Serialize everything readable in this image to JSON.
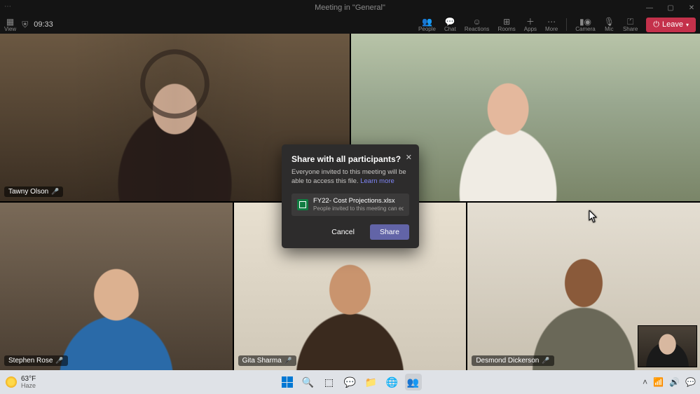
{
  "titlebar": {
    "title": "Meeting in \"General\""
  },
  "toolbar": {
    "view_label": "View",
    "time": "09:33",
    "actions": {
      "people": "People",
      "chat": "Chat",
      "reactions": "Reactions",
      "rooms": "Rooms",
      "apps": "Apps",
      "more": "More",
      "camera": "Camera",
      "mic": "Mic",
      "share": "Share"
    },
    "leave_label": "Leave"
  },
  "participants": [
    {
      "name": "Tawny Olson"
    },
    {
      "name": ""
    },
    {
      "name": "Stephen Rose"
    },
    {
      "name": "Gita Sharma"
    },
    {
      "name": "Desmond Dickerson"
    }
  ],
  "dialog": {
    "title": "Share with all participants?",
    "body": "Everyone invited to this meeting will be able to access this file.",
    "learn_more": "Learn more",
    "file_name": "FY22- Cost Projections.xlsx",
    "file_sub": "People invited to this meeting can edit",
    "cancel": "Cancel",
    "share": "Share"
  },
  "taskbar": {
    "temp": "63°F",
    "desc": "Haze"
  }
}
